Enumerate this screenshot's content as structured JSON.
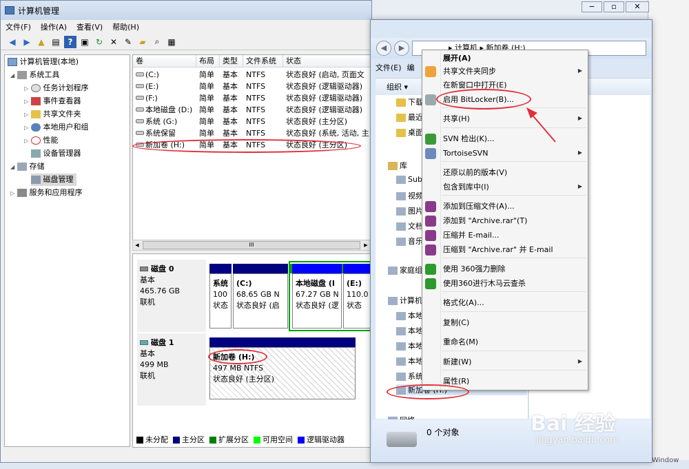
{
  "mmc": {
    "title": "计算机管理",
    "menu": [
      "文件(F)",
      "操作(A)",
      "查看(V)",
      "帮助(H)"
    ],
    "tree": [
      {
        "label": "计算机管理(本地)",
        "level": 0
      },
      {
        "label": "系统工具",
        "level": 1
      },
      {
        "label": "任务计划程序",
        "level": 2
      },
      {
        "label": "事件查看器",
        "level": 2
      },
      {
        "label": "共享文件夹",
        "level": 2
      },
      {
        "label": "本地用户和组",
        "level": 2
      },
      {
        "label": "性能",
        "level": 2
      },
      {
        "label": "设备管理器",
        "level": 2
      },
      {
        "label": "存储",
        "level": 1
      },
      {
        "label": "磁盘管理",
        "level": 2
      },
      {
        "label": "服务和应用程序",
        "level": 1
      }
    ],
    "columns": [
      "卷",
      "布局",
      "类型",
      "文件系统",
      "状态"
    ],
    "volumes": [
      [
        "(C:)",
        "简单",
        "基本",
        "NTFS",
        "状态良好 (启动, 页面文"
      ],
      [
        "(E:)",
        "简单",
        "基本",
        "NTFS",
        "状态良好 (逻辑驱动器)"
      ],
      [
        "(F:)",
        "简单",
        "基本",
        "NTFS",
        "状态良好 (逻辑驱动器)"
      ],
      [
        "本地磁盘 (D:)",
        "简单",
        "基本",
        "NTFS",
        "状态良好 (逻辑驱动器)"
      ],
      [
        "系统 (G:)",
        "简单",
        "基本",
        "NTFS",
        "状态良好 (主分区)"
      ],
      [
        "系统保留",
        "简单",
        "基本",
        "NTFS",
        "状态良好 (系统, 活动, 主"
      ],
      [
        "新加卷 (H:)",
        "简单",
        "基本",
        "NTFS",
        "状态良好 (主分区)"
      ]
    ],
    "disk0": {
      "name": "磁盘 0",
      "type": "基本",
      "size": "465.76 GB",
      "status": "联机",
      "parts": [
        {
          "l1": "系统",
          "l2": "100",
          "l3": "状态"
        },
        {
          "l1": "(C:)",
          "l2": "68.65 GB N",
          "l3": "状态良好 (启"
        },
        {
          "l1": "本地磁盘 (I",
          "l2": "67.27 GB N",
          "l3": "状态良好 (逻"
        },
        {
          "l1": "(E:)",
          "l2": "110.0",
          "l3": "状态"
        }
      ]
    },
    "disk1": {
      "name": "磁盘 1",
      "type": "基本",
      "size": "499 MB",
      "status": "联机",
      "part": {
        "l1": "新加卷 (H:)",
        "l2": "497 MB NTFS",
        "l3": "状态良好 (主分区)"
      }
    },
    "legend": [
      {
        "label": "未分配",
        "color": "#000000"
      },
      {
        "label": "主分区",
        "color": "#000080"
      },
      {
        "label": "扩展分区",
        "color": "#008000"
      },
      {
        "label": "可用空间",
        "color": "#00ff00"
      },
      {
        "label": "逻辑驱动器",
        "color": "#0000ff"
      }
    ],
    "scroll_glyph": "III"
  },
  "explorer": {
    "path": [
      "计算机",
      "新加卷 (H:)"
    ],
    "menu": [
      "文件(E)",
      "编"
    ],
    "organize": "组织",
    "nav": [
      "下载",
      "最近",
      "桌面",
      "库",
      "Sub",
      "视频",
      "图片",
      "文档",
      "音乐",
      "家庭组",
      "计算机",
      "本地",
      "本地",
      "本地",
      "本地",
      "系统",
      "新加卷 (H:)",
      "网络"
    ],
    "status": "0 个对象"
  },
  "context_menu": [
    {
      "label": "展开(A)",
      "bold": true
    },
    {
      "label": "共享文件夹同步",
      "sub": true,
      "icon": "sync-icon"
    },
    {
      "label": "在新窗口中打开(E)"
    },
    {
      "label": "启用 BitLocker(B)...",
      "icon": "bitlocker-icon"
    },
    {
      "label": "共享(H)",
      "sub": true
    },
    {
      "label": "SVN 检出(K)...",
      "icon": "svn-icon"
    },
    {
      "label": "TortoiseSVN",
      "sub": true,
      "icon": "tortoise-icon"
    },
    {
      "label": "还原以前的版本(V)"
    },
    {
      "label": "包含到库中(I)",
      "sub": true
    },
    {
      "label": "添加到压缩文件(A)...",
      "icon": "winrar-icon"
    },
    {
      "label": "添加到 \"Archive.rar\"(T)",
      "icon": "winrar-icon"
    },
    {
      "label": "压缩并 E-mail...",
      "icon": "winrar-icon"
    },
    {
      "label": "压缩到 \"Archive.rar\" 并 E-mail",
      "icon": "winrar-icon"
    },
    {
      "label": "使用 360强力删除",
      "icon": "360-icon"
    },
    {
      "label": "使用360进行木马云查杀",
      "icon": "360-icon"
    },
    {
      "label": "格式化(A)..."
    },
    {
      "label": "复制(C)"
    },
    {
      "label": "重命名(M)"
    },
    {
      "label": "新建(W)",
      "sub": true
    },
    {
      "label": "属性(R)"
    }
  ],
  "watermark": {
    "text": "Bai 经验",
    "url": "jingyan.baidu.com"
  },
  "taskbar_text": "Window"
}
